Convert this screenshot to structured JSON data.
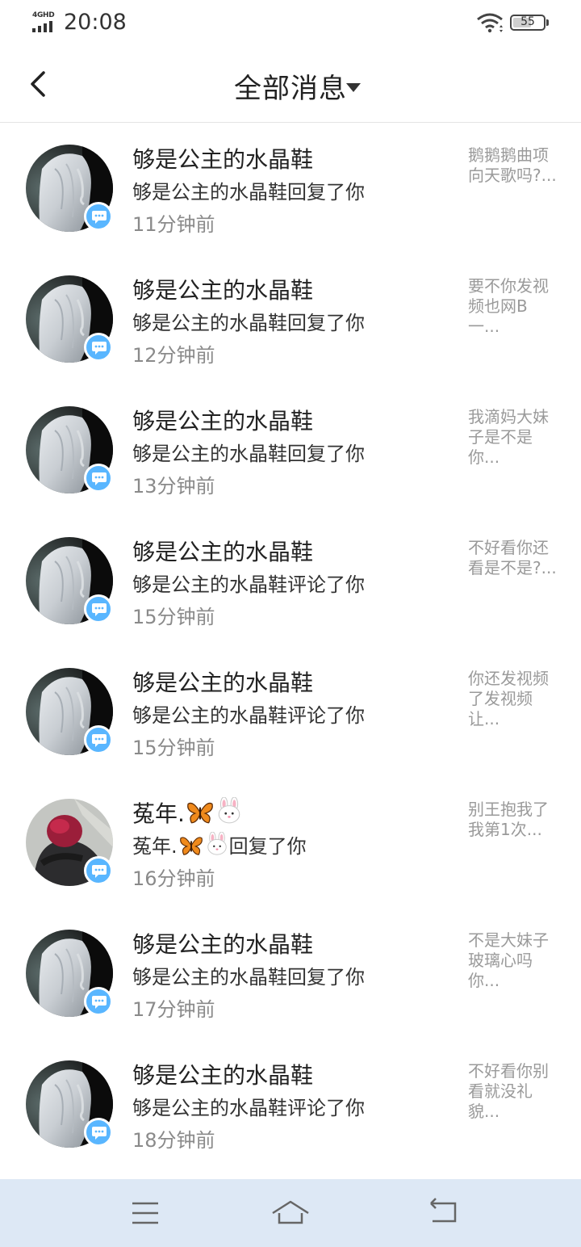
{
  "status_bar": {
    "network": "4GHD",
    "time": "20:08",
    "battery": "55"
  },
  "header": {
    "title": "全部消息"
  },
  "messages": [
    {
      "name": "够是公主的水晶鞋",
      "action": "够是公主的水晶鞋回复了你",
      "time": "11分钟前",
      "preview": "鹅鹅鹅曲项向天歌吗?...",
      "avatar": "silver-hair-avatar"
    },
    {
      "name": "够是公主的水晶鞋",
      "action": "够是公主的水晶鞋回复了你",
      "time": "12分钟前",
      "preview": "要不你发视频也网B一...",
      "avatar": "silver-hair-avatar"
    },
    {
      "name": "够是公主的水晶鞋",
      "action": "够是公主的水晶鞋回复了你",
      "time": "13分钟前",
      "preview": "我滴妈大妹子是不是你...",
      "avatar": "silver-hair-avatar"
    },
    {
      "name": "够是公主的水晶鞋",
      "action": "够是公主的水晶鞋评论了你",
      "time": "15分钟前",
      "preview": "不好看你还看是不是?...",
      "avatar": "silver-hair-avatar"
    },
    {
      "name": "够是公主的水晶鞋",
      "action": "够是公主的水晶鞋评论了你",
      "time": "15分钟前",
      "preview": "你还发视频了发视频让...",
      "avatar": "silver-hair-avatar"
    },
    {
      "name": "菟年.",
      "action_prefix": "菟年.",
      "action_suffix": "回复了你",
      "time": "16分钟前",
      "preview": "别王抱我了 我第1次...",
      "avatar": "red-hair-avatar",
      "emojis": [
        "butterfly-icon",
        "rabbit-icon"
      ]
    },
    {
      "name": "够是公主的水晶鞋",
      "action": "够是公主的水晶鞋回复了你",
      "time": "17分钟前",
      "preview": "不是大妹子玻璃心吗你...",
      "avatar": "silver-hair-avatar"
    },
    {
      "name": "够是公主的水晶鞋",
      "action": "够是公主的水晶鞋评论了你",
      "time": "18分钟前",
      "preview": "不好看你别看就没礼貌...",
      "avatar": "silver-hair-avatar"
    }
  ],
  "nav": {
    "buttons": [
      "menu-icon",
      "home-icon",
      "back-icon"
    ]
  },
  "colors": {
    "badge": "#59b6ff",
    "nav_bar": "#dde8f5"
  }
}
